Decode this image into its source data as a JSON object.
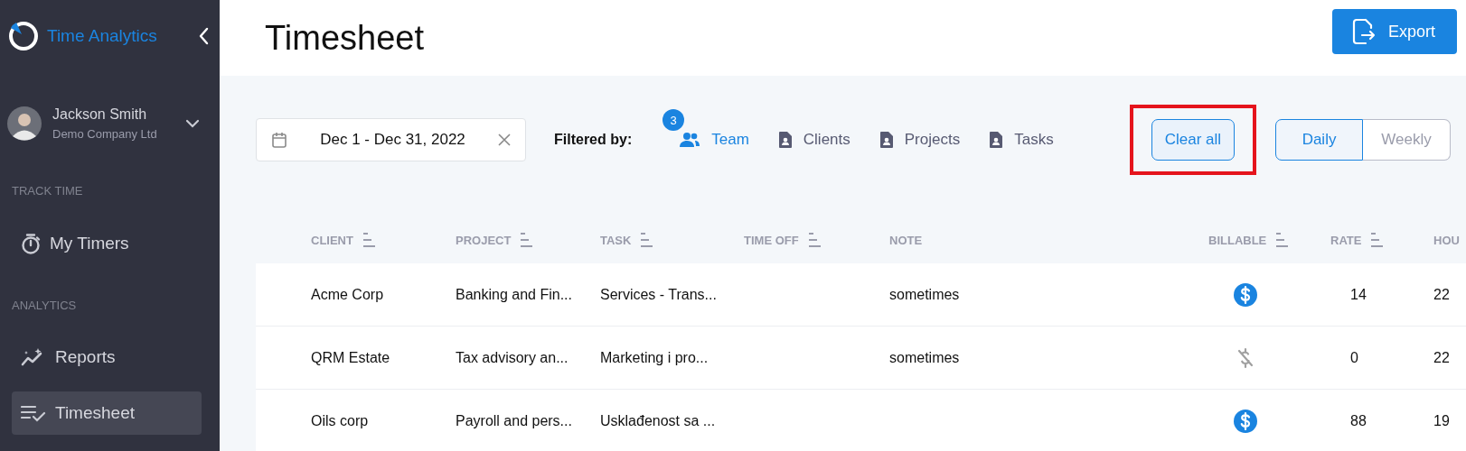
{
  "sidebar": {
    "app_name": "Time Analytics",
    "user": {
      "name": "Jackson Smith",
      "company": "Demo Company Ltd"
    },
    "sections": [
      {
        "title": "TRACK TIME",
        "items": [
          {
            "label": "My Timers",
            "kind": "timer",
            "selected": false
          }
        ]
      },
      {
        "title": "ANALYTICS",
        "items": [
          {
            "label": "Reports",
            "kind": "reports",
            "selected": false
          },
          {
            "label": "Timesheet",
            "kind": "timesheet",
            "selected": true
          }
        ]
      }
    ]
  },
  "header": {
    "title": "Timesheet",
    "export_button": "Export"
  },
  "filter_bar": {
    "date_range": "Dec 1 - Dec 31, 2022",
    "filtered_by_label": "Filtered by:",
    "filters": [
      {
        "label": "Team",
        "kind": "team",
        "active": true,
        "badge": "3"
      },
      {
        "label": "Clients",
        "kind": "contact",
        "active": false
      },
      {
        "label": "Projects",
        "kind": "contact",
        "active": false
      },
      {
        "label": "Tasks",
        "kind": "contact",
        "active": false
      }
    ],
    "clear_all": {
      "label": "Clear all",
      "highlighted": true
    },
    "view_toggle": [
      {
        "label": "Daily",
        "selected": true
      },
      {
        "label": "Weekly",
        "selected": false
      }
    ]
  },
  "table": {
    "columns": [
      {
        "label": "CLIENT",
        "sortable": true
      },
      {
        "label": "PROJECT",
        "sortable": true
      },
      {
        "label": "TASK",
        "sortable": true
      },
      {
        "label": "TIME OFF",
        "sortable": true
      },
      {
        "label": "NOTE",
        "sortable": false
      },
      {
        "label": "BILLABLE",
        "sortable": true
      },
      {
        "label": "RATE",
        "sortable": true
      },
      {
        "label": "HOU",
        "sortable": false
      }
    ],
    "rows": [
      {
        "client": "Acme Corp",
        "project": "Banking and Fin...",
        "task": "Services - Trans...",
        "note": "sometimes",
        "billable": true,
        "rate": "14",
        "column_8": "22"
      },
      {
        "client": "QRM Estate",
        "project": "Tax advisory an...",
        "task": "Marketing i pro...",
        "note": "sometimes",
        "billable": false,
        "rate": "0",
        "column_8": "22"
      },
      {
        "client": "Oils corp",
        "project": "Payroll and pers...",
        "task": "Usklađenost sa ...",
        "billable": true,
        "rate": "88",
        "column_8": "19"
      }
    ]
  }
}
